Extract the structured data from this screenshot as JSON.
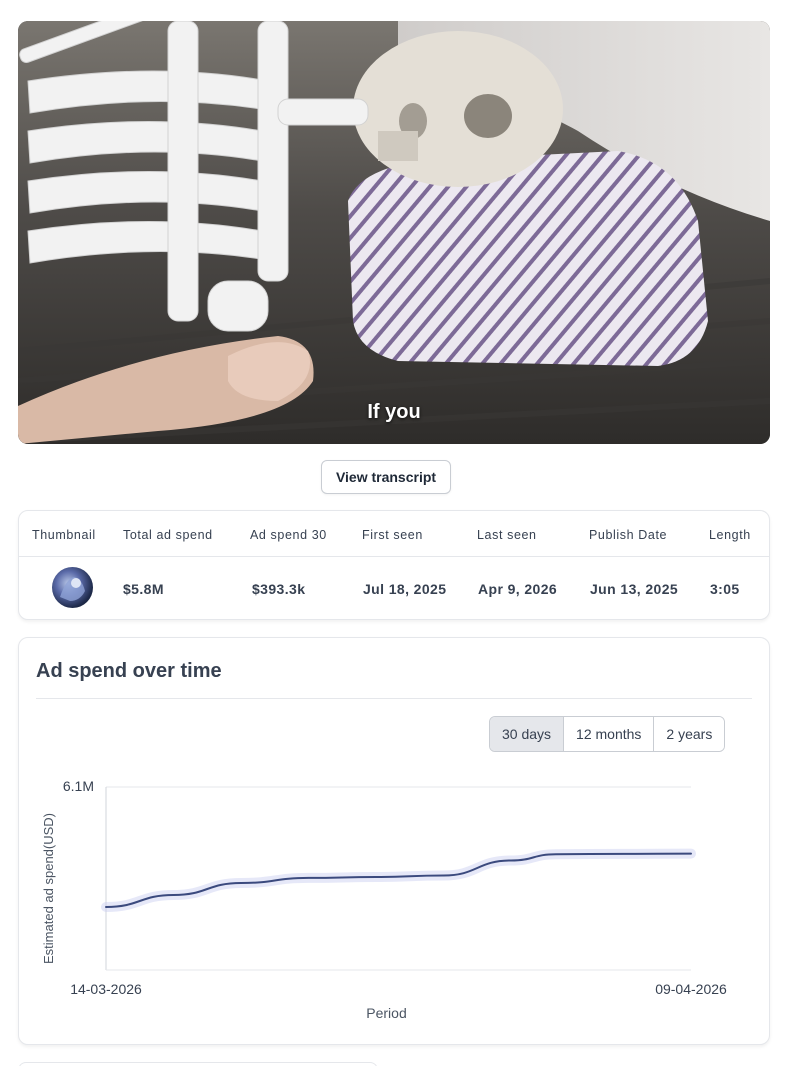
{
  "video": {
    "caption": "If you"
  },
  "transcript_button": "View transcript",
  "stats": {
    "headers": [
      "Thumbnail",
      "Total ad spend",
      "Ad spend 30",
      "First seen",
      "Last seen",
      "Publish Date",
      "Length"
    ],
    "values": {
      "total_ad_spend": "$5.8M",
      "ad_spend_30": "$393.3k",
      "first_seen": "Jul 18, 2025",
      "last_seen": "Apr 9, 2026",
      "publish_date": "Jun 13, 2025",
      "length": "3:05"
    }
  },
  "chart_section": {
    "title": "Ad spend over time",
    "ranges": [
      "30 days",
      "12 months",
      "2 years"
    ],
    "active_range": "30 days"
  },
  "chart_data": {
    "type": "line",
    "xlabel": "Period",
    "ylabel": "Estimated ad spend(USD)",
    "x_tick_labels": [
      "14-03-2026",
      "09-04-2026"
    ],
    "y_tick_labels": [
      "6.1M"
    ],
    "ylim": [
      0,
      6100000
    ],
    "color": "#3b4a7e",
    "grid": true,
    "series": [
      {
        "x": [
          "14-03-2026",
          "17-03-2026",
          "20-03-2026",
          "23-03-2026",
          "26-03-2026",
          "29-03-2026",
          "01-04-2026",
          "03-04-2026",
          "06-04-2026",
          "09-04-2026"
        ],
        "values": [
          2100000,
          2500000,
          2900000,
          3070000,
          3100000,
          3150000,
          3650000,
          3860000,
          3870000,
          3880000
        ]
      }
    ]
  }
}
